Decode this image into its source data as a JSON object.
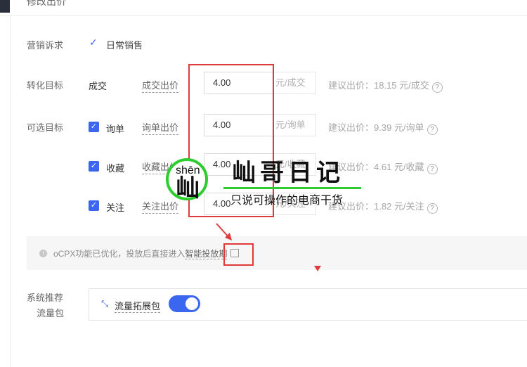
{
  "header": {
    "title": "修改出价"
  },
  "rows": {
    "marketing": {
      "label": "营销诉求",
      "value": "日常销售"
    },
    "conversion": {
      "label": "转化目标",
      "name": "成交",
      "bid_label": "成交出价",
      "value": "4.00",
      "unit": "元/成交",
      "suggest": "建议出价：18.15 元/成交"
    },
    "optional_label": "可选目标",
    "optional": [
      {
        "name": "询单",
        "bid_label": "询单出价",
        "value": "4.00",
        "unit": "元/询单",
        "suggest": "建议出价：9.39 元/询单"
      },
      {
        "name": "收藏",
        "bid_label": "收藏出价",
        "value": "4.00",
        "unit": "元/收藏",
        "suggest": "建议出价：4.61 元/收藏"
      },
      {
        "name": "关注",
        "bid_label": "关注出价",
        "value": "4.00",
        "unit": "元/关注",
        "suggest": "建议出价：1.82 元/关注"
      }
    ]
  },
  "notice": {
    "text": "oCPX功能已优化，投放后直接进入",
    "link": "智能投放期"
  },
  "recommend": {
    "label_line1": "系统推荐",
    "label_line2": "流量包",
    "item": "流量拓展包",
    "toggle_on": true
  },
  "watermark": {
    "pinyin": "shēn",
    "char": "屾",
    "title": "屾哥日记",
    "subtitle": "只说可操作的电商干货"
  },
  "colors": {
    "accent": "#3a66f0",
    "annotation": "#e03a3a",
    "watermark": "#2ecc2e"
  }
}
